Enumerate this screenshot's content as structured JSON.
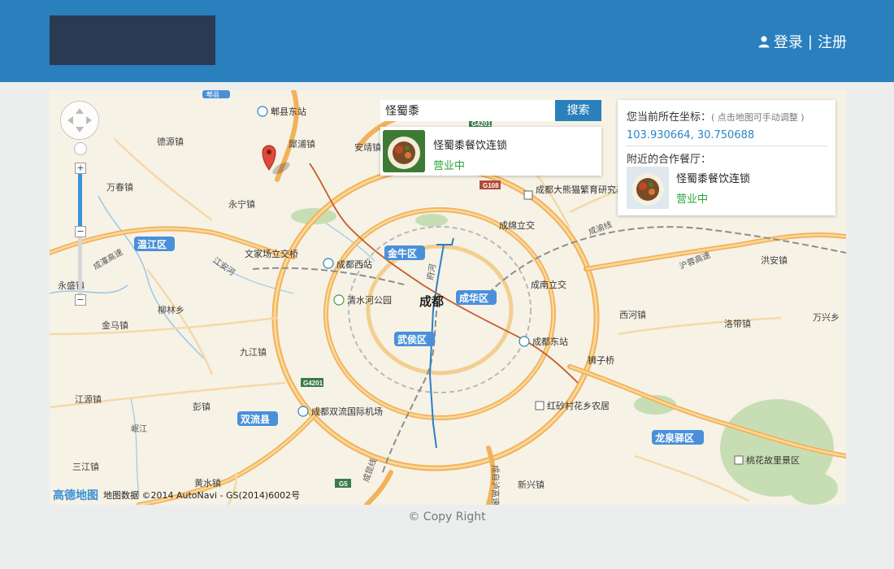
{
  "header": {
    "auth": {
      "login": "登录",
      "separator": "|",
      "register": "注册"
    }
  },
  "search": {
    "value": "怪蜀黍",
    "button": "搜索"
  },
  "result": {
    "name": "怪蜀黍餐饮连锁",
    "status": "营业中"
  },
  "info_panel": {
    "title": "您当前所在坐标：",
    "hint": "( 点击地图可手动调整 )",
    "coordinates": "103.930664, 30.750688",
    "nearby_title": "附近的合作餐厅：",
    "nearby": [
      {
        "name": "怪蜀黍餐饮连锁",
        "status": "营业中"
      }
    ]
  },
  "map_labels": {
    "districts": [
      "温江区",
      "金牛区",
      "成华区",
      "武侯区",
      "双流县",
      "龙泉驿区"
    ],
    "city": "成都",
    "places": [
      "德源镇",
      "万春镇",
      "永宁镇",
      "永盛镇",
      "柳林乡",
      "金马镇",
      "九江镇",
      "江源镇",
      "彭镇",
      "三江镇",
      "黄水镇",
      "安靖镇",
      "犀浦镇",
      "西河镇",
      "洪安镇",
      "万兴乡",
      "洛带镇",
      "新兴镇"
    ],
    "landmarks": [
      "郫县东站",
      "文家场立交桥",
      "成都西站",
      "清水河公园",
      "成都大熊猫繁育研究基地",
      "成绵立交",
      "成南立交",
      "成都东站",
      "狮子桥",
      "成都双流国际机场",
      "红砂村花乡农居",
      "桃花故里景区"
    ],
    "roads": [
      "成灌高速",
      "成渝线",
      "沪蓉高速",
      "江安河",
      "成自泸高速",
      "府河",
      "岷江",
      "成昆线"
    ],
    "highway_shields": [
      "G4201",
      "G108",
      "G4201",
      "G5"
    ],
    "north_tag": "郫县"
  },
  "attribution": {
    "logo": "高德地图",
    "text": "地图数据 ©2014 AutoNavi - GS(2014)6002号"
  },
  "footer": {
    "copyright": "© Copy Right"
  },
  "colors": {
    "header": "#2a7fbd",
    "logo": "#2a3a52",
    "button": "#2a7fbd",
    "status": "#2aa63a",
    "coordinates": "#2a84c4",
    "map_bg": "#f6f2e6",
    "major_road": "#f2b25a",
    "district_label": "#4a90d9"
  }
}
